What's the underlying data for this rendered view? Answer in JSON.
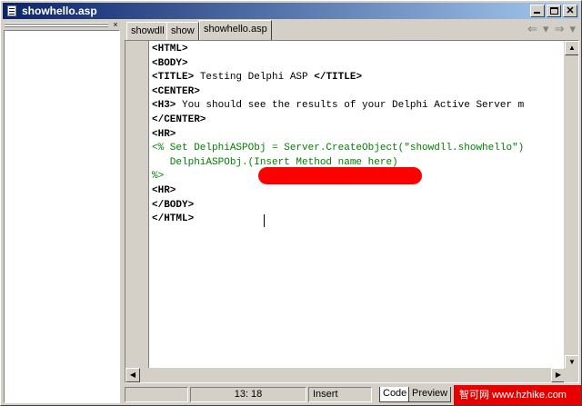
{
  "window": {
    "title": "showhello.asp",
    "minimize_glyph": "_",
    "maximize_glyph": "□",
    "close_glyph": "✕"
  },
  "left_panel": {
    "close_glyph": "×"
  },
  "tabs": [
    {
      "label": "showdll"
    },
    {
      "label": "show"
    },
    {
      "label": "showhello.asp"
    }
  ],
  "nav": {
    "back": "⇐",
    "back_drop": "▾",
    "forward": "⇒",
    "forward_drop": "▾"
  },
  "code_lines": [
    {
      "tag": "<HTML>"
    },
    {
      "tag": "<BODY>"
    },
    {
      "pre": "<TITLE>",
      "text": " Testing Delphi ASP ",
      "post": "</TITLE>"
    },
    {
      "tag": "<CENTER>"
    },
    {
      "pre": "<H3>",
      "text": " You should see the results of your Delphi Active Server m"
    },
    {
      "tag": "</CENTER>"
    },
    {
      "tag": "<HR>"
    },
    {
      "green": "<% Set DelphiASPObj = Server.CreateObject(\"showdll.showhello\")"
    },
    {
      "green": "   DelphiASPObj.(Insert Method name here)"
    },
    {
      "green": "%>"
    },
    {
      "tag": "<HR>"
    },
    {
      "tag": "</BODY>"
    },
    {
      "tag": "</HTML>"
    }
  ],
  "statusbar": {
    "position": "13: 18",
    "mode": "Insert",
    "tab_code": "Code",
    "tab_preview": "Preview"
  },
  "watermark": "智可网 www.hzhike.com",
  "colors": {
    "titlebar_start": "#0a246a",
    "titlebar_end": "#a6caf0",
    "code_green": "#008000",
    "annotation_red": "#ff0000"
  }
}
